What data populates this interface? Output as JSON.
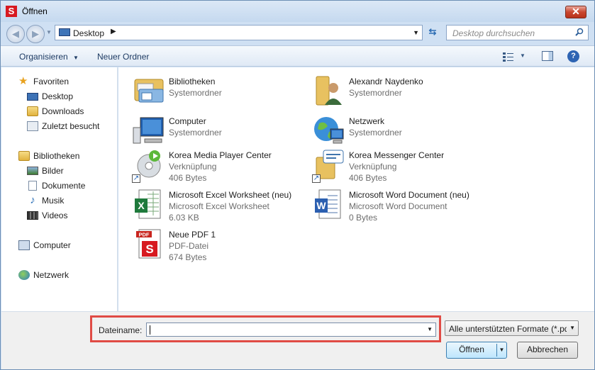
{
  "window": {
    "title": "Öffnen",
    "app_icon_letter": "S",
    "close_glyph": "✕"
  },
  "address_bar": {
    "location": "Desktop",
    "breadcrumb_arrow": "▶",
    "dropdown_glyph": "▼",
    "refresh_glyph": "⇆"
  },
  "search": {
    "placeholder": "Desktop durchsuchen"
  },
  "toolbar": {
    "organize_label": "Organisieren",
    "organize_arrow": "▼",
    "new_folder_label": "Neuer Ordner",
    "view_dropdown_glyph": "▼",
    "help_glyph": "?"
  },
  "nav": {
    "favorites": "Favoriten",
    "desktop": "Desktop",
    "downloads": "Downloads",
    "recent": "Zuletzt besucht",
    "libraries": "Bibliotheken",
    "pictures": "Bilder",
    "documents": "Dokumente",
    "music": "Musik",
    "videos": "Videos",
    "computer": "Computer",
    "network": "Netzwerk"
  },
  "files": [
    {
      "name": "Bibliotheken",
      "type": "Systemordner",
      "size": "",
      "icon": "libraries-icon"
    },
    {
      "name": "Alexandr Naydenko",
      "type": "Systemordner",
      "size": "",
      "icon": "user-folder-icon"
    },
    {
      "name": "Computer",
      "type": "Systemordner",
      "size": "",
      "icon": "computer-icon"
    },
    {
      "name": "Netzwerk",
      "type": "Systemordner",
      "size": "",
      "icon": "network-icon"
    },
    {
      "name": "Korea Media Player Center",
      "type": "Verknüpfung",
      "size": "406 Bytes",
      "icon": "media-player-shortcut-icon"
    },
    {
      "name": "Korea Messenger Center",
      "type": "Verknüpfung",
      "size": "406 Bytes",
      "icon": "messenger-shortcut-icon"
    },
    {
      "name": "Microsoft Excel Worksheet (neu)",
      "type": "Microsoft Excel Worksheet",
      "size": "6.03 KB",
      "icon": "excel-icon"
    },
    {
      "name": "Microsoft Word Document (neu)",
      "type": "Microsoft Word Document",
      "size": "0 Bytes",
      "icon": "word-icon"
    },
    {
      "name": "Neue PDF 1",
      "type": "PDF-Datei",
      "size": "674 Bytes",
      "icon": "pdf-icon"
    }
  ],
  "shortcut_glyph": "↗",
  "bottom": {
    "filename_label": "Dateiname:",
    "filename_value": "",
    "filename_dropdown_glyph": "▼",
    "file_type": "Alle unterstützten Formate (*.pdf",
    "file_type_dropdown_glyph": "▼",
    "open_button": "Öffnen",
    "open_split_glyph": "▼",
    "cancel_button": "Abbrechen"
  }
}
